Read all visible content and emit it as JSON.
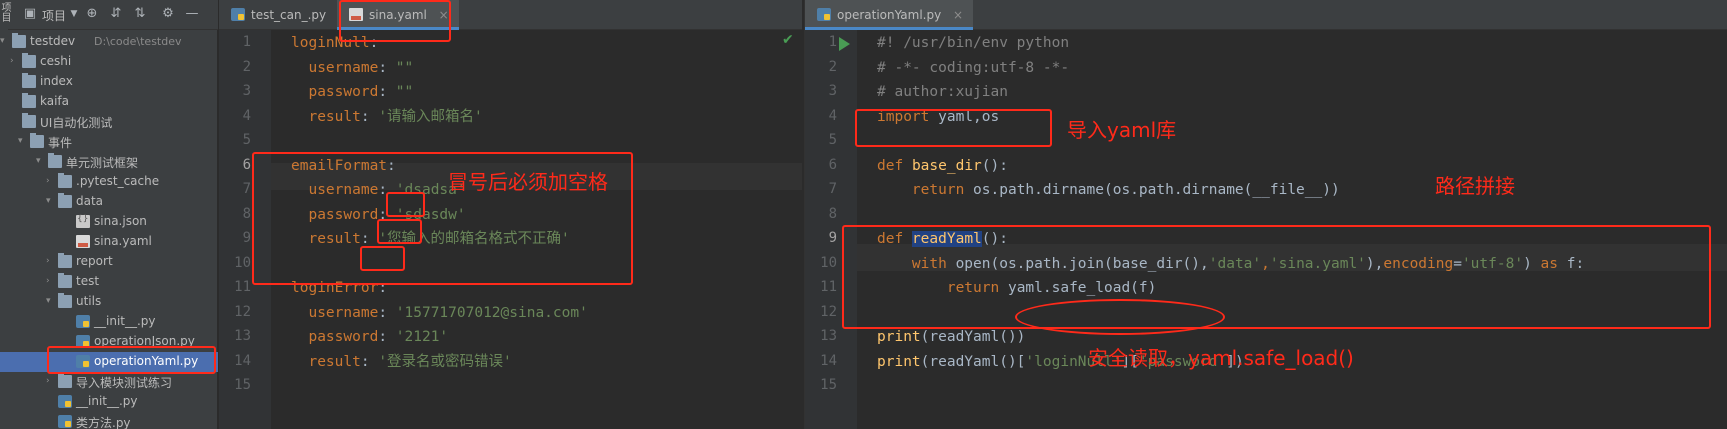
{
  "project_panel": {
    "toolbar_label": "项目",
    "side_strip_label": "项目",
    "tree": [
      {
        "label": "testdev",
        "path": "D:\\code\\testdev",
        "type": "root"
      },
      {
        "label": "ceshi",
        "type": "folder"
      },
      {
        "label": "index",
        "type": "folder"
      },
      {
        "label": "kaifa",
        "type": "folder"
      },
      {
        "label": "UI自动化测试",
        "type": "folder"
      },
      {
        "label": "事件",
        "type": "folder"
      },
      {
        "label": "单元测试框架",
        "type": "folder"
      },
      {
        "label": ".pytest_cache",
        "type": "folder"
      },
      {
        "label": "data",
        "type": "folder"
      },
      {
        "label": "sina.json",
        "type": "json"
      },
      {
        "label": "sina.yaml",
        "type": "yaml"
      },
      {
        "label": "report",
        "type": "folder"
      },
      {
        "label": "test",
        "type": "folder"
      },
      {
        "label": "utils",
        "type": "folder"
      },
      {
        "label": "__init__.py",
        "type": "py"
      },
      {
        "label": "operationJson.py",
        "type": "py"
      },
      {
        "label": "operationYaml.py",
        "type": "py",
        "selected": true
      },
      {
        "label": "导入模块测试练习",
        "type": "folder"
      },
      {
        "label": "__init__.py",
        "type": "py"
      },
      {
        "label": "类方法.py",
        "type": "py"
      }
    ]
  },
  "left_editor": {
    "tabs": [
      {
        "label": "test_can_.py",
        "close": "×"
      },
      {
        "label": "sina.yaml",
        "close": "×",
        "active": true
      }
    ],
    "line_numbers": [
      "1",
      "2",
      "3",
      "4",
      "5",
      "6",
      "7",
      "8",
      "9",
      "10",
      "11",
      "12",
      "13",
      "14",
      "15"
    ],
    "lines": [
      [
        {
          "t": "loginNull",
          "c": "key"
        },
        {
          "t": ":",
          "c": "plain"
        }
      ],
      [
        {
          "t": "  username",
          "c": "key"
        },
        {
          "t": ": ",
          "c": "plain"
        },
        {
          "t": "\"\"",
          "c": "str"
        }
      ],
      [
        {
          "t": "  password",
          "c": "key"
        },
        {
          "t": ": ",
          "c": "plain"
        },
        {
          "t": "\"\"",
          "c": "str"
        }
      ],
      [
        {
          "t": "  result",
          "c": "key"
        },
        {
          "t": ": ",
          "c": "plain"
        },
        {
          "t": "'请输入邮箱名'",
          "c": "str"
        }
      ],
      [],
      [
        {
          "t": "emailFormat",
          "c": "key"
        },
        {
          "t": ":",
          "c": "plain"
        }
      ],
      [
        {
          "t": "  username",
          "c": "key"
        },
        {
          "t": ": ",
          "c": "plain"
        },
        {
          "t": "'dsadsa'",
          "c": "str"
        }
      ],
      [
        {
          "t": "  password",
          "c": "key"
        },
        {
          "t": ": ",
          "c": "plain"
        },
        {
          "t": "'sdasdw'",
          "c": "str"
        }
      ],
      [
        {
          "t": "  result",
          "c": "key"
        },
        {
          "t": ": ",
          "c": "plain"
        },
        {
          "t": "'您输入的邮箱名格式不正确'",
          "c": "str"
        }
      ],
      [],
      [
        {
          "t": "loginError",
          "c": "key"
        },
        {
          "t": ":",
          "c": "plain"
        }
      ],
      [
        {
          "t": "  username",
          "c": "key"
        },
        {
          "t": ": ",
          "c": "plain"
        },
        {
          "t": "'15771707012@sina.com'",
          "c": "str"
        }
      ],
      [
        {
          "t": "  password",
          "c": "key"
        },
        {
          "t": ": ",
          "c": "plain"
        },
        {
          "t": "'2121'",
          "c": "str"
        }
      ],
      [
        {
          "t": "  result",
          "c": "key"
        },
        {
          "t": ": ",
          "c": "plain"
        },
        {
          "t": "'登录名或密码错误'",
          "c": "str"
        }
      ],
      []
    ],
    "annotation": "冒号后必须加空格"
  },
  "right_editor": {
    "tabs": [
      {
        "label": "operationYaml.py",
        "close": "×",
        "active": true
      }
    ],
    "line_numbers": [
      "1",
      "2",
      "3",
      "4",
      "5",
      "6",
      "7",
      "8",
      "9",
      "10",
      "11",
      "12",
      "13",
      "14",
      "15"
    ],
    "lines": [
      [
        {
          "t": "#! /usr/bin/env python",
          "c": "cmt"
        }
      ],
      [
        {
          "t": "# -*- coding:utf-8 -*-",
          "c": "cmt"
        }
      ],
      [
        {
          "t": "# author:xujian",
          "c": "cmt"
        }
      ],
      [
        {
          "t": "import",
          "c": "kw"
        },
        {
          "t": " yaml,os",
          "c": "plain"
        }
      ],
      [],
      [
        {
          "t": "def",
          "c": "kw"
        },
        {
          "t": " ",
          "c": "plain"
        },
        {
          "t": "base_dir",
          "c": "fn"
        },
        {
          "t": "():",
          "c": "plain"
        }
      ],
      [
        {
          "t": "    ",
          "c": "plain"
        },
        {
          "t": "return",
          "c": "kw"
        },
        {
          "t": " os.path.dirname(os.path.dirname(__file__))",
          "c": "plain"
        }
      ],
      [],
      [
        {
          "t": "def",
          "c": "kw"
        },
        {
          "t": " ",
          "c": "plain"
        },
        {
          "t": "readYaml",
          "c": "fn"
        },
        {
          "t": "():",
          "c": "plain"
        }
      ],
      [
        {
          "t": "    ",
          "c": "plain"
        },
        {
          "t": "with",
          "c": "kw"
        },
        {
          "t": " open(os.path.join(base_dir(),",
          "c": "plain"
        },
        {
          "t": "'data'",
          "c": "str"
        },
        {
          "t": ",",
          "c": "kw"
        },
        {
          "t": "'sina.yaml'",
          "c": "str"
        },
        {
          "t": "),",
          "c": "plain"
        },
        {
          "t": "encoding",
          "c": "kw"
        },
        {
          "t": "=",
          "c": "plain"
        },
        {
          "t": "'utf-8'",
          "c": "str"
        },
        {
          "t": ") ",
          "c": "plain"
        },
        {
          "t": "as",
          "c": "kw"
        },
        {
          "t": " f:",
          "c": "plain"
        }
      ],
      [
        {
          "t": "        ",
          "c": "plain"
        },
        {
          "t": "return",
          "c": "kw"
        },
        {
          "t": " yaml.safe_load(f)",
          "c": "plain"
        }
      ],
      [],
      [
        {
          "t": "print",
          "c": "fn"
        },
        {
          "t": "(readYaml())",
          "c": "plain"
        }
      ],
      [
        {
          "t": "print",
          "c": "fn"
        },
        {
          "t": "(readYaml()[",
          "c": "plain"
        },
        {
          "t": "'loginNull'",
          "c": "str"
        },
        {
          "t": "][",
          "c": "plain"
        },
        {
          "t": "'password'",
          "c": "str"
        },
        {
          "t": "])",
          "c": "plain"
        }
      ],
      []
    ],
    "annotation_import": "导入yaml库",
    "annotation_path": "路径拼接",
    "annotation_safe": "安全读取，yaml.safe_load()"
  },
  "colors": {
    "annotation": "#ff2a1a",
    "selection": "#4b6eaf",
    "string": "#6a8759",
    "keyword": "#cc7832",
    "function": "#ffc66d"
  }
}
